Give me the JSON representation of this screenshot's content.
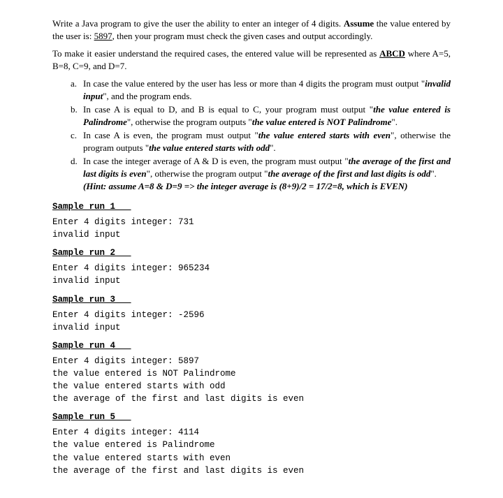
{
  "intro": {
    "p1_pre": "Write a Java program to give the user the ability to enter an integer of 4 digits. ",
    "p1_assume": "Assume",
    "p1_mid": " the value entered by the user is: ",
    "p1_val": "5897",
    "p1_post": ", then your program must check the given cases and output accordingly.",
    "p2_pre": "To make it easier understand the required cases, the entered value will be represented as ",
    "p2_abcd": "ABCD",
    "p2_post": " where A=5, B=8, C=9, and D=7."
  },
  "items": {
    "a": {
      "label": "a.",
      "t1": "In case the value entered by the user has less or more than 4 digits the program must output \"",
      "q1": "invalid input",
      "t2": "\", and the program ends."
    },
    "b": {
      "label": "b.",
      "t1": "In case A is equal to D, and B is equal to C, your program must output \"",
      "q1": "the value entered is Palindrome",
      "t2": "\", otherwise the program outputs \"",
      "q2": "the value entered is NOT Palindrome",
      "t3": "\"."
    },
    "c": {
      "label": "c.",
      "t1": "In case A is even, the program must output \"",
      "q1": "the value entered starts with even",
      "t2": "\", otherwise the program outputs \"",
      "q2": "the value entered starts with odd",
      "t3": "\"."
    },
    "d": {
      "label": "d.",
      "t1": "In case the integer average of A & D is even, the program must output \"",
      "q1": "the average of the first and last digits is even",
      "t2": "\", otherwise the program output \"",
      "q2": "the average of the first and last digits is odd",
      "t3": "\".",
      "hint": "(Hint: assume A=8 & D=9 => the integer average is (8+9)/2 = 17/2=8, which is EVEN)"
    }
  },
  "samples": {
    "s1": {
      "heading": "Sample run 1",
      "body": "Enter 4 digits integer: 731\ninvalid input"
    },
    "s2": {
      "heading": "Sample run 2",
      "body": "Enter 4 digits integer: 965234\ninvalid input"
    },
    "s3": {
      "heading": "Sample run 3",
      "body": "Enter 4 digits integer: -2596\ninvalid input"
    },
    "s4": {
      "heading": "Sample run 4",
      "body": "Enter 4 digits integer: 5897\nthe value entered is NOT Palindrome\nthe value entered starts with odd\nthe average of the first and last digits is even"
    },
    "s5": {
      "heading": "Sample run 5",
      "body": "Enter 4 digits integer: 4114\nthe value entered is Palindrome\nthe value entered starts with even\nthe average of the first and last digits is even"
    }
  }
}
